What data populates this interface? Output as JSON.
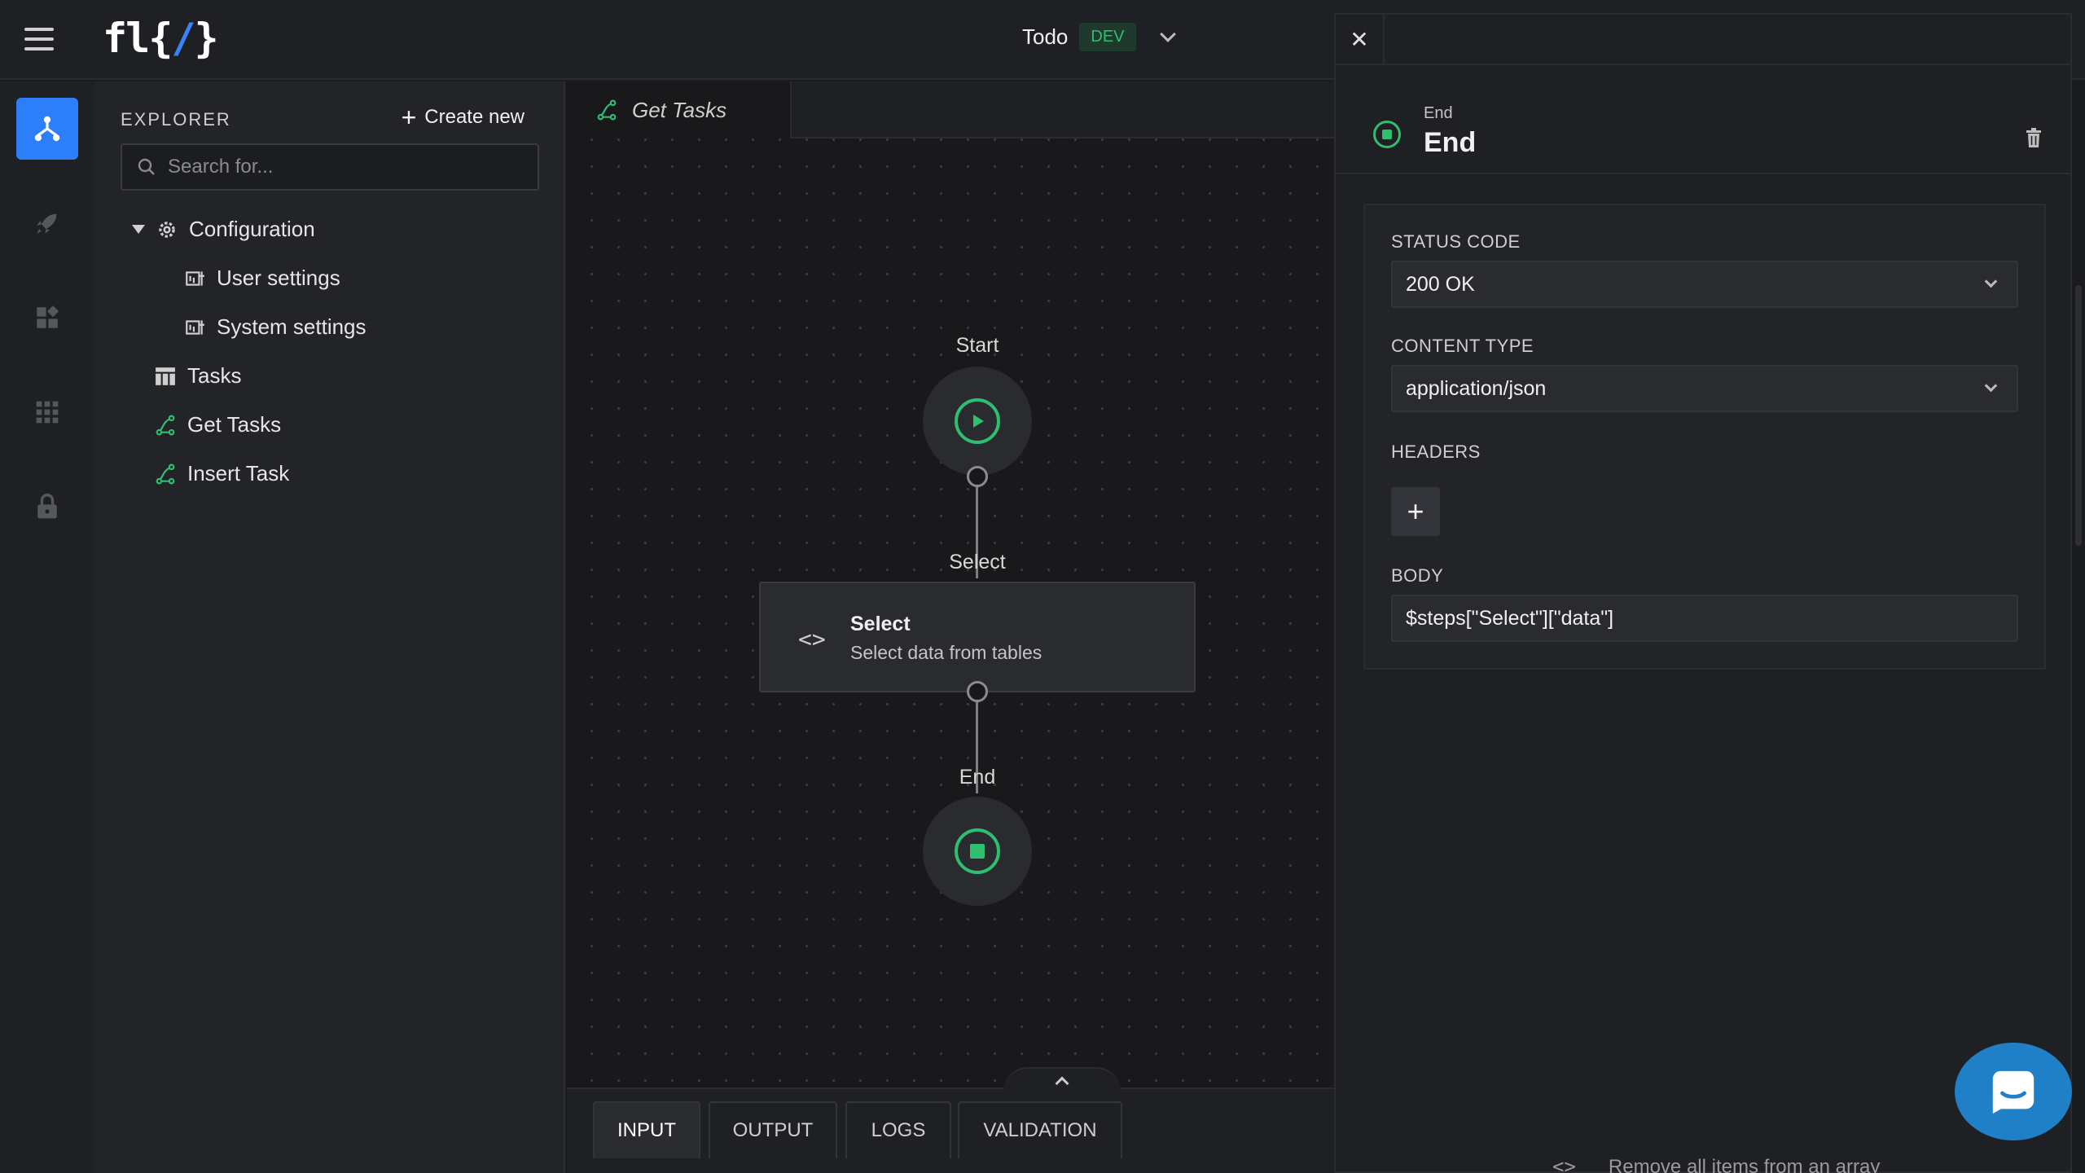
{
  "header": {
    "logo_text": "fl{/}",
    "project_name": "Todo",
    "env_badge": "DEV"
  },
  "rail": {
    "items": [
      "flows-icon",
      "rocket-icon",
      "widgets-icon",
      "apps-grid-icon",
      "lock-icon"
    ]
  },
  "sidebar": {
    "title": "EXPLORER",
    "create_label": "Create new",
    "search_placeholder": "Search for...",
    "tree": {
      "configuration": "Configuration",
      "user_settings": "User settings",
      "system_settings": "System settings",
      "tasks": "Tasks",
      "get_tasks": "Get Tasks",
      "insert_task": "Insert Task"
    }
  },
  "editor": {
    "tab_label": "Get Tasks",
    "nodes": {
      "start_label": "Start",
      "select_label": "Select",
      "select_title": "Select",
      "select_subtitle": "Select data from tables",
      "end_label": "End"
    },
    "bottom_tabs": [
      "INPUT",
      "OUTPUT",
      "LOGS",
      "VALIDATION"
    ],
    "active_bottom_tab": "INPUT",
    "peek_text": "Remove all items from an array"
  },
  "panel": {
    "kind": "End",
    "name": "End",
    "status_code_label": "STATUS CODE",
    "status_code_value": "200 OK",
    "content_type_label": "CONTENT TYPE",
    "content_type_value": "application/json",
    "headers_label": "HEADERS",
    "add_header": "+",
    "body_label": "BODY",
    "body_value": "$steps[\"Select\"][\"data\"]"
  },
  "colors": {
    "accent": "#2d7ff9",
    "success": "#2fbf71",
    "chat": "#1f7fc7"
  }
}
